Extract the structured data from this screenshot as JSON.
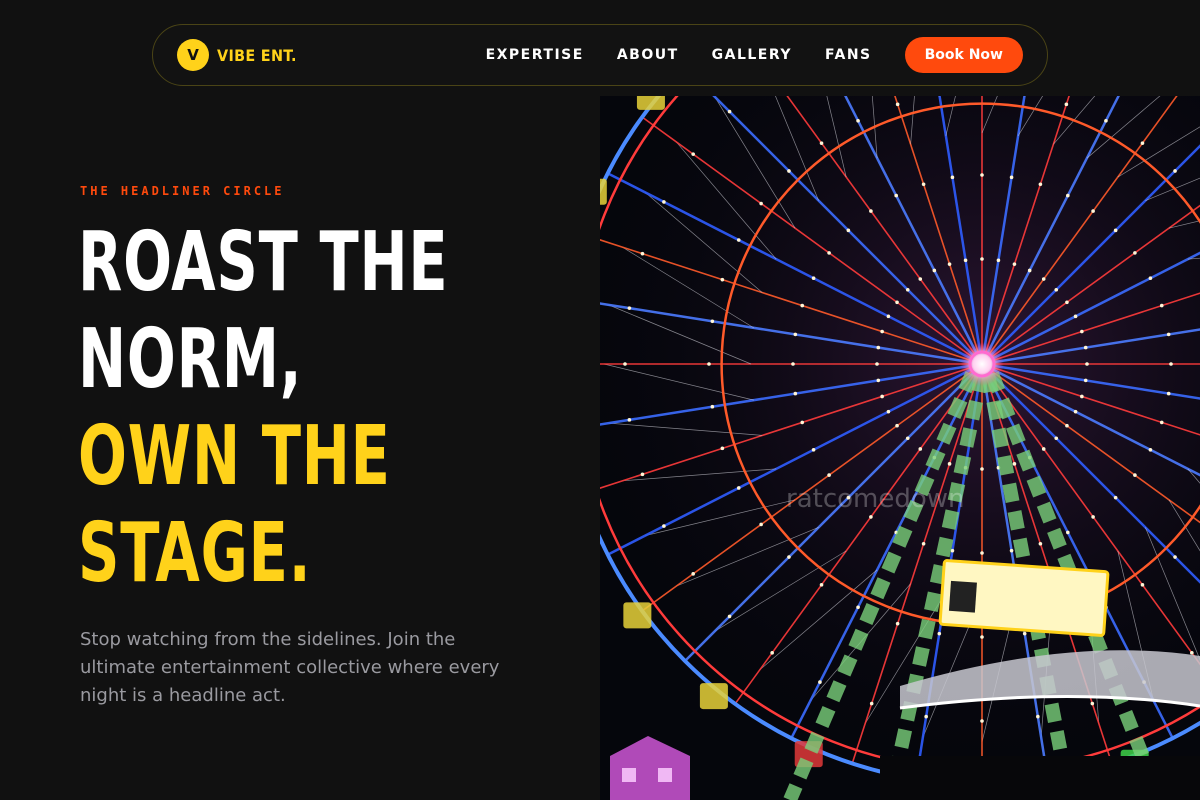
{
  "brand": {
    "initial": "V",
    "name": "VIBE ENT."
  },
  "nav": {
    "links": [
      "EXPERTISE",
      "ABOUT",
      "GALLERY",
      "FANS"
    ],
    "cta": "Book Now"
  },
  "hero": {
    "eyebrow": "THE HEADLINER CIRCLE",
    "headline_lines": [
      "ROAST THE",
      "NORM,",
      "OWN THE",
      "STAGE."
    ],
    "lead": "Stop watching from the sidelines. Join the ultimate entertainment collective where every night is a headline act.",
    "image": {
      "subject": "illuminated ferris wheel at night",
      "watermark": "ratcomedown"
    }
  },
  "colors": {
    "background": "#111111",
    "accent_yellow": "#ffd21a",
    "accent_orange": "#ff4a0d",
    "muted_text": "#9a9aa0"
  }
}
